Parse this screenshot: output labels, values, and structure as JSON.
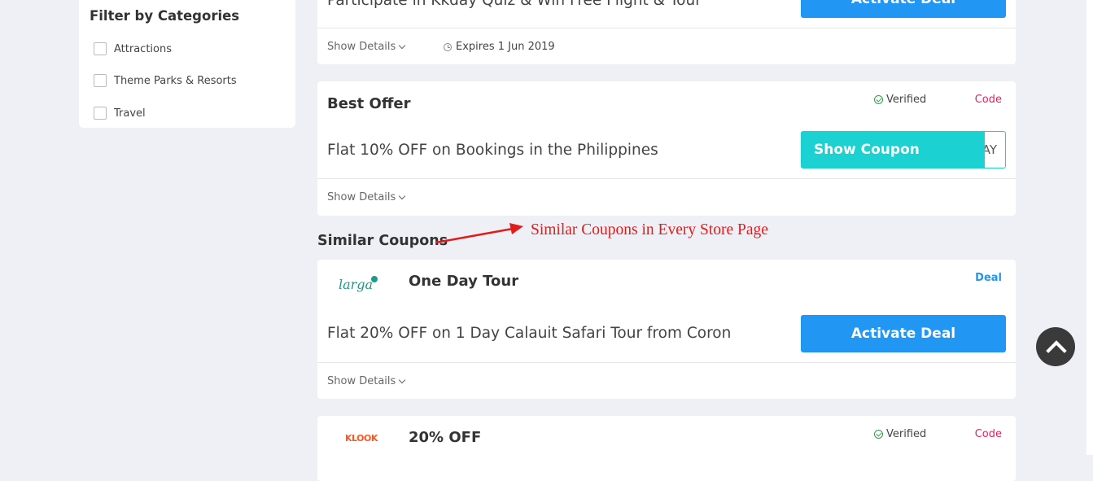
{
  "sidebar": {
    "title": "Filter by Categories",
    "categories": [
      {
        "label": "Attractions",
        "checked": false
      },
      {
        "label": "Theme Parks & Resorts",
        "checked": false
      },
      {
        "label": "Travel",
        "checked": false
      }
    ]
  },
  "coupons": [
    {
      "description": "Participate in Kkday Quiz & Win Free Flight & Tour",
      "button_label": "Activate Deal",
      "details_label": "Show Details",
      "expires": "Expires 1 Jun 2019"
    },
    {
      "title": "Best Offer",
      "verified_label": "Verified",
      "type_tag": "Code",
      "description": "Flat 10% OFF on Bookings in the Philippines",
      "button_label": "Show Coupon",
      "code_peek": "AY",
      "details_label": "Show Details"
    }
  ],
  "similar": {
    "section_title": "Similar Coupons",
    "annotation": "Similar Coupons in Every Store Page",
    "items": [
      {
        "logo_text": "larga",
        "title": "One Day Tour",
        "type_tag": "Deal",
        "description": "Flat 20% OFF on 1 Day Calauit Safari Tour from Coron",
        "button_label": "Activate Deal",
        "details_label": "Show Details"
      },
      {
        "logo_text": "KLOOK",
        "title": "20% OFF",
        "verified_label": "Verified",
        "type_tag": "Code"
      }
    ]
  },
  "colors": {
    "accent_blue": "#2196f3",
    "coupon_teal": "#1bd1d1",
    "code_pink": "#e91e63",
    "verified_green": "#2e9e4b",
    "annotation_red": "#e21b1b"
  },
  "icons": [
    "chevron-down-icon",
    "clock-icon",
    "check-circle-icon",
    "arrow-icon",
    "chevron-up-icon"
  ]
}
